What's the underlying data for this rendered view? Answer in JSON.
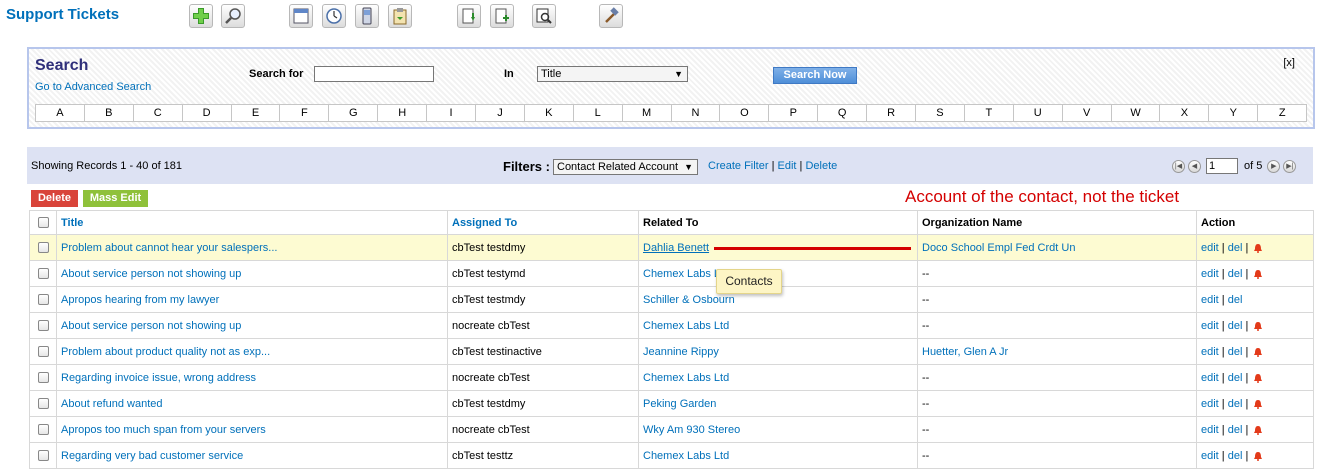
{
  "header": {
    "title": "Support Tickets",
    "toolbar": [
      {
        "name": "add-icon"
      },
      {
        "name": "search-icon"
      },
      {
        "name": "calendar-icon"
      },
      {
        "name": "clock-icon"
      },
      {
        "name": "phone-icon"
      },
      {
        "name": "clipboard-icon"
      },
      {
        "name": "import-icon"
      },
      {
        "name": "export-icon"
      },
      {
        "name": "find-duplicates-icon"
      },
      {
        "name": "settings-hammer-icon"
      }
    ]
  },
  "search": {
    "title": "Search",
    "advanced_link": "Go to Advanced Search",
    "search_for_label": "Search for",
    "search_for_value": "",
    "in_label": "In",
    "in_value": "Title",
    "button": "Search Now",
    "close": "[x]",
    "alphabet": [
      "A",
      "B",
      "C",
      "D",
      "E",
      "F",
      "G",
      "H",
      "I",
      "J",
      "K",
      "L",
      "M",
      "N",
      "O",
      "P",
      "Q",
      "R",
      "S",
      "T",
      "U",
      "V",
      "W",
      "X",
      "Y",
      "Z"
    ]
  },
  "records": {
    "showing": "Showing Records 1 - 40 of 181",
    "filters_label": "Filters :",
    "filter_value": "Contact Related Account",
    "create_filter": "Create Filter",
    "edit": "Edit",
    "delete": "Delete",
    "page_value": "1",
    "of_pages": "of 5"
  },
  "actions": {
    "delete": "Delete",
    "mass_edit": "Mass Edit"
  },
  "annotation": {
    "text": "Account of the contact, not the ticket",
    "tooltip": "Contacts",
    "color": "#d40000"
  },
  "table": {
    "columns": [
      "Title",
      "Assigned To",
      "Related To",
      "Organization Name",
      "Action"
    ],
    "edit_label": "edit",
    "del_label": "del",
    "rows": [
      {
        "title": "Problem about cannot hear your salespers...",
        "assigned": "cbTest testdmy",
        "related": "Dahlia Benett",
        "org": "Doco School Empl Fed Crdt Un",
        "bell": true,
        "highlight": true
      },
      {
        "title": "About service person not showing up",
        "assigned": "cbTest testymd",
        "related": "Chemex Labs Ltd",
        "org": "--",
        "bell": true
      },
      {
        "title": "Apropos hearing from my lawyer",
        "assigned": "cbTest testmdy",
        "related": "Schiller & Osbourn",
        "org": "--",
        "bell": false
      },
      {
        "title": "About service person not showing up",
        "assigned": "nocreate cbTest",
        "related": "Chemex Labs Ltd",
        "org": "--",
        "bell": true
      },
      {
        "title": "Problem about product quality not as exp...",
        "assigned": "cbTest testinactive",
        "related": "Jeannine Rippy",
        "org": "Huetter, Glen A Jr",
        "bell": true
      },
      {
        "title": "Regarding invoice issue, wrong address",
        "assigned": "nocreate cbTest",
        "related": "Chemex Labs Ltd",
        "org": "--",
        "bell": true
      },
      {
        "title": "About refund wanted",
        "assigned": "cbTest testdmy",
        "related": "Peking Garden",
        "org": "--",
        "bell": true
      },
      {
        "title": "Apropos too much span from your servers",
        "assigned": "nocreate cbTest",
        "related": "Wky Am 930 Stereo",
        "org": "--",
        "bell": true
      },
      {
        "title": "Regarding very bad customer service",
        "assigned": "cbTest testtz",
        "related": "Chemex Labs Ltd",
        "org": "--",
        "bell": true
      }
    ]
  }
}
